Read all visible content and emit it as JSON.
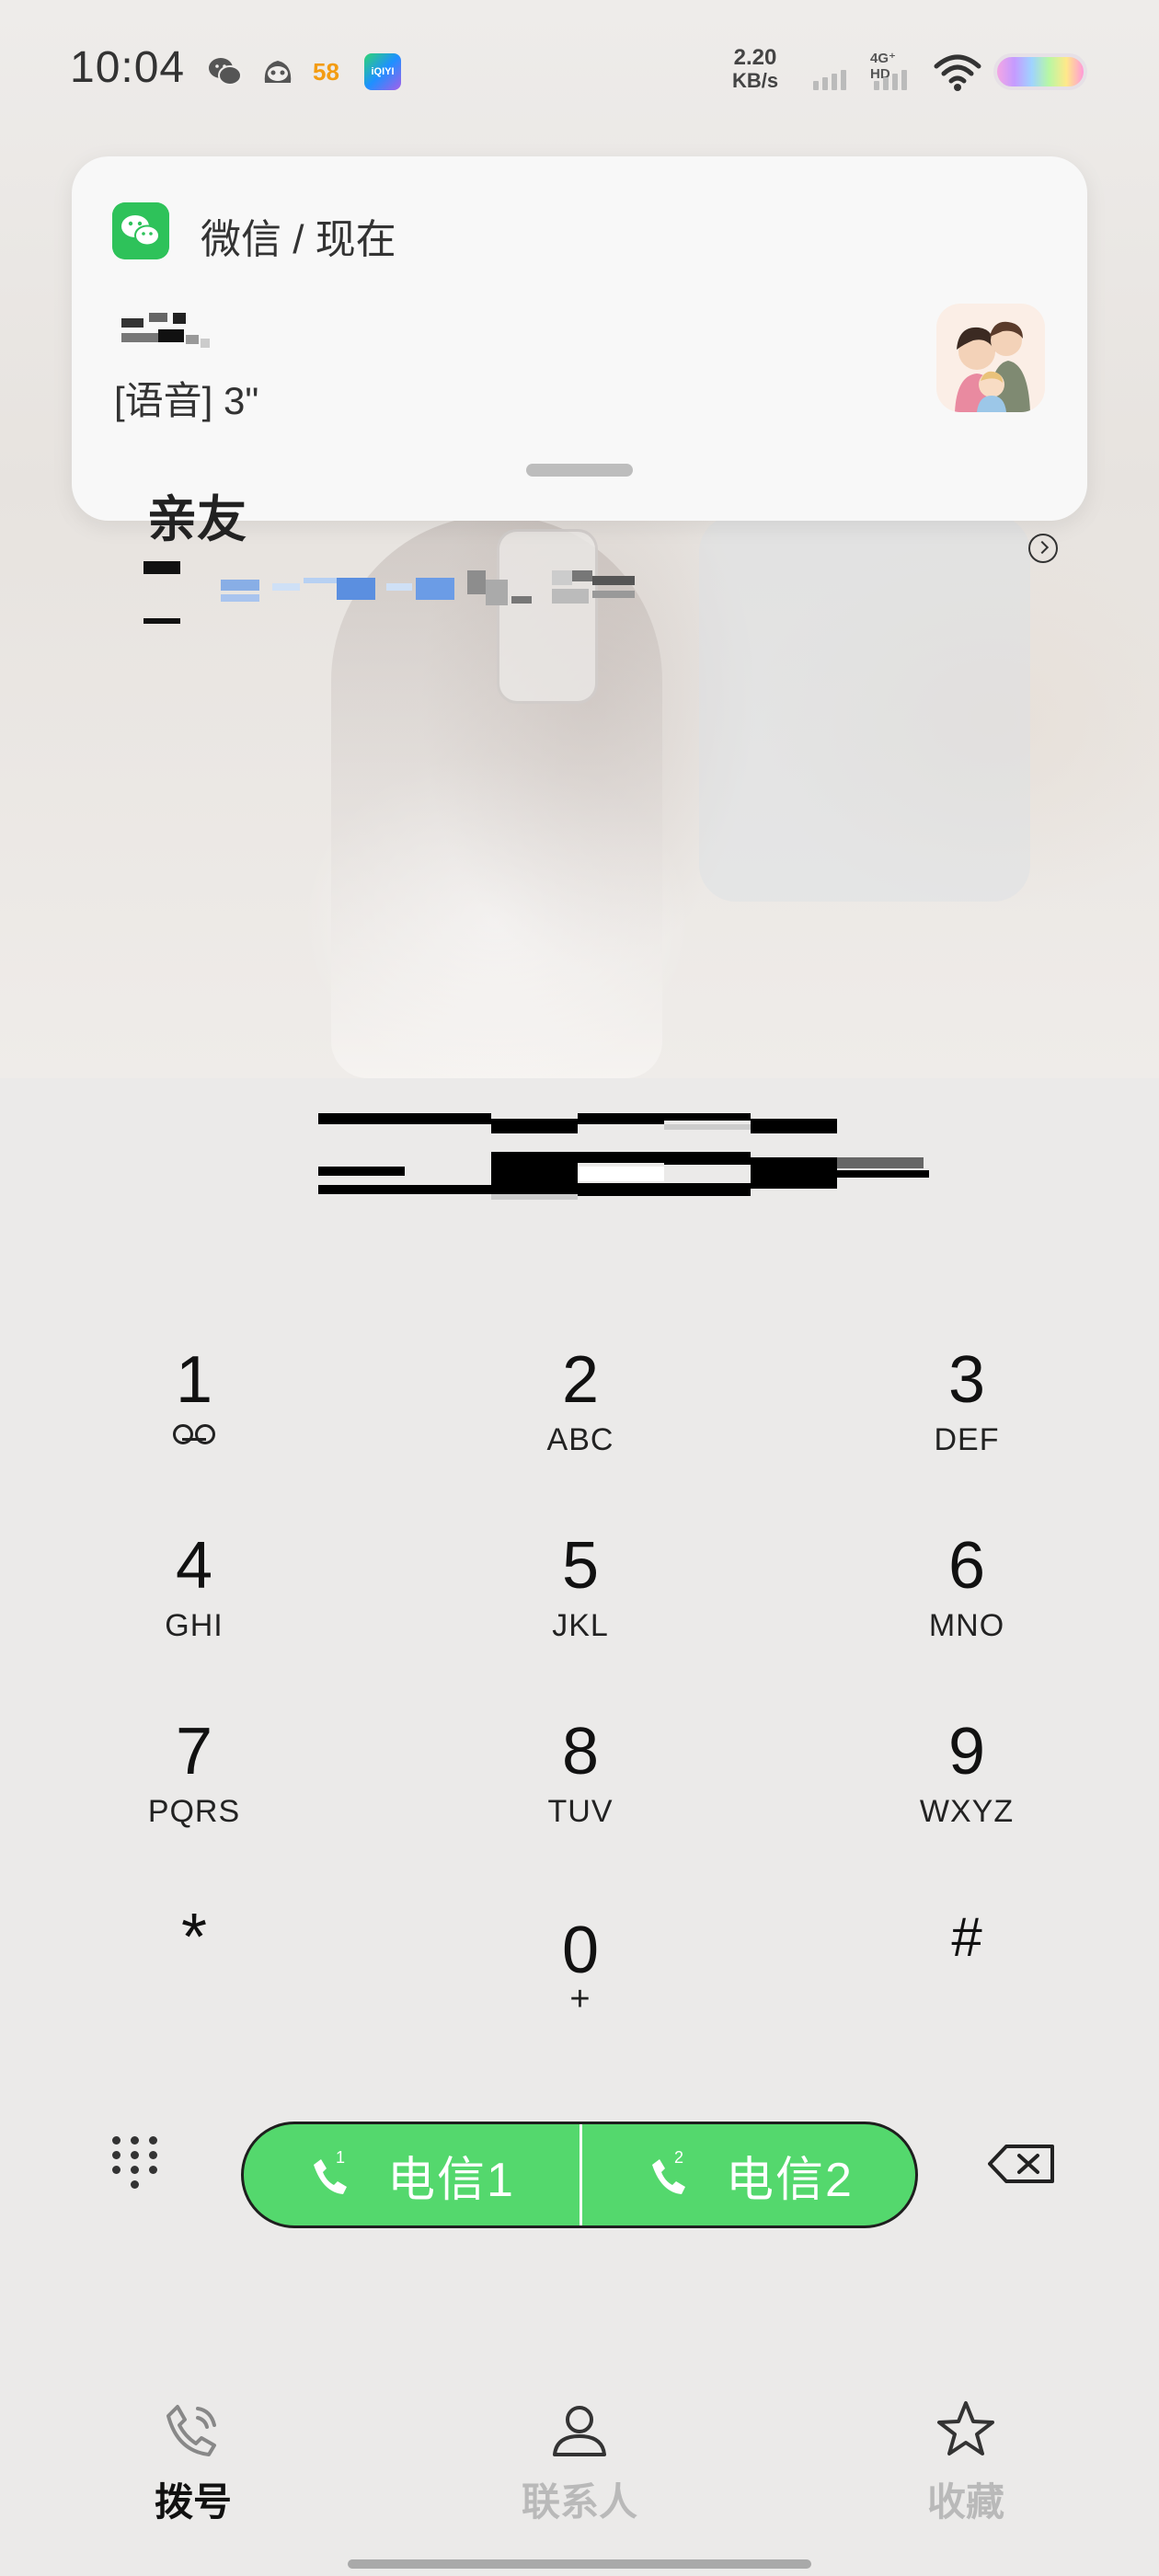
{
  "status_bar": {
    "time": "10:04",
    "net_speed_value": "2.20",
    "net_speed_unit": "KB/s",
    "network_type": "4G⁺ HD",
    "app_icons": [
      "wechat-icon",
      "qq-icon",
      "58-icon",
      "iqiyi-icon"
    ],
    "app_58_label": "58",
    "app_iqiyi_label": "iQIYI"
  },
  "notification": {
    "app_name": "微信 / 现在",
    "message": "[语音] 3\""
  },
  "contact": {
    "name_partial": "亲友"
  },
  "keypad": {
    "keys": [
      {
        "digit": "1",
        "letters": ""
      },
      {
        "digit": "2",
        "letters": "ABC"
      },
      {
        "digit": "3",
        "letters": "DEF"
      },
      {
        "digit": "4",
        "letters": "GHI"
      },
      {
        "digit": "5",
        "letters": "JKL"
      },
      {
        "digit": "6",
        "letters": "MNO"
      },
      {
        "digit": "7",
        "letters": "PQRS"
      },
      {
        "digit": "8",
        "letters": "TUV"
      },
      {
        "digit": "9",
        "letters": "WXYZ"
      },
      {
        "digit": "*",
        "letters": ""
      },
      {
        "digit": "0",
        "letters": "+"
      },
      {
        "digit": "#",
        "letters": ""
      }
    ]
  },
  "call_bar": {
    "sim1_label": "电信1",
    "sim2_label": "电信2",
    "sim1_badge": "1",
    "sim2_badge": "2"
  },
  "bottom_nav": {
    "dial": "拨号",
    "contacts": "联系人",
    "favorites": "收藏",
    "active": "dial"
  },
  "colors": {
    "call_green": "#54d86d",
    "wechat_green": "#2ec25a",
    "inactive_nav": "#b9b9b9"
  }
}
